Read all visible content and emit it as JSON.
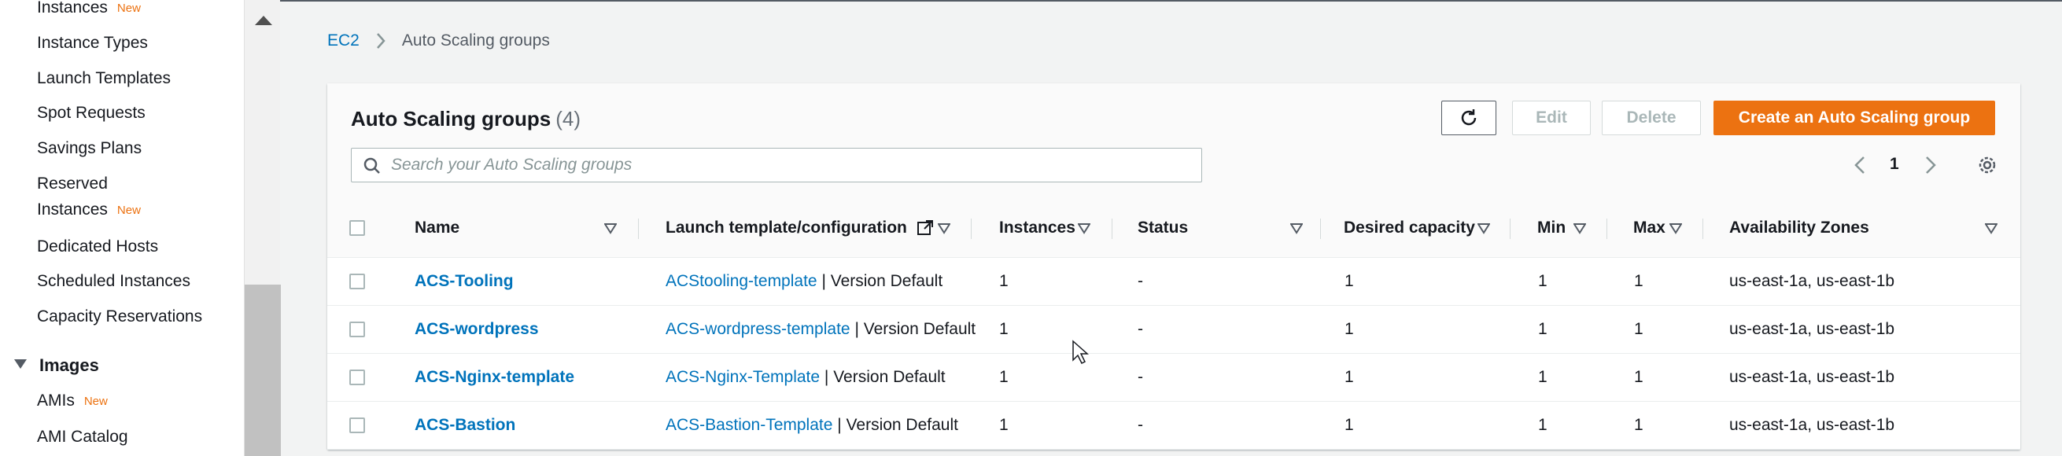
{
  "sidebar": {
    "items": [
      {
        "label": "Instances",
        "badge": "New"
      },
      {
        "label": "Instance Types"
      },
      {
        "label": "Launch Templates"
      },
      {
        "label": "Spot Requests"
      },
      {
        "label": "Savings Plans"
      },
      {
        "label_line1": "Reserved",
        "label_line2": "Instances",
        "badge": "New"
      },
      {
        "label": "Dedicated Hosts"
      },
      {
        "label": "Scheduled Instances"
      },
      {
        "label": "Capacity Reservations"
      }
    ],
    "section": "Images",
    "section_items": [
      {
        "label": "AMIs",
        "badge": "New"
      },
      {
        "label": "AMI Catalog"
      }
    ]
  },
  "breadcrumb": {
    "root": "EC2",
    "separator": ">",
    "current": "Auto Scaling groups"
  },
  "panel": {
    "title": "Auto Scaling groups",
    "count": "(4)",
    "buttons": {
      "edit": "Edit",
      "delete": "Delete",
      "create": "Create an Auto Scaling group"
    },
    "search_placeholder": "Search your Auto Scaling groups",
    "page": "1"
  },
  "table": {
    "columns": [
      "Name",
      "Launch template/configuration",
      "Instances",
      "Status",
      "Desired capacity",
      "Min",
      "Max",
      "Availability Zones"
    ],
    "rows": [
      {
        "name": "ACS-Tooling",
        "template": "ACStooling-template",
        "version": "| Version Default",
        "instances": "1",
        "status": "-",
        "desired": "1",
        "min": "1",
        "max": "1",
        "zones": "us-east-1a, us-east-1b"
      },
      {
        "name": "ACS-wordpress",
        "template": "ACS-wordpress-template",
        "version": "| Version Default",
        "instances": "1",
        "status": "-",
        "desired": "1",
        "min": "1",
        "max": "1",
        "zones": "us-east-1a, us-east-1b"
      },
      {
        "name": "ACS-Nginx-template",
        "template": "ACS-Nginx-Template",
        "version": "| Version Default",
        "instances": "1",
        "status": "-",
        "desired": "1",
        "min": "1",
        "max": "1",
        "zones": "us-east-1a, us-east-1b"
      },
      {
        "name": "ACS-Bastion",
        "template": "ACS-Bastion-Template",
        "version": "| Version Default",
        "instances": "1",
        "status": "-",
        "desired": "1",
        "min": "1",
        "max": "1",
        "zones": "us-east-1a, us-east-1b"
      }
    ]
  },
  "colors": {
    "link": "#0073bb",
    "primary_button": "#ec7211",
    "new_badge": "#ec7211"
  }
}
